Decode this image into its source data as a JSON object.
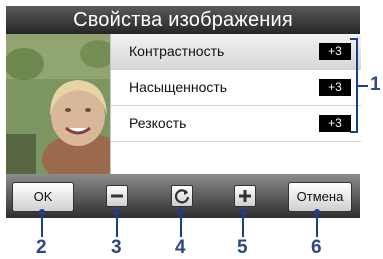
{
  "window": {
    "title": "Свойства изображения"
  },
  "properties": [
    {
      "label": "Контрастность",
      "value": "+3"
    },
    {
      "label": "Насыщенность",
      "value": "+3"
    },
    {
      "label": "Резкость",
      "value": "+3"
    }
  ],
  "toolbar": {
    "ok_label": "OK",
    "cancel_label": "Отмена"
  },
  "callouts": {
    "c1": "1",
    "c2": "2",
    "c3": "3",
    "c4": "4",
    "c5": "5",
    "c6": "6"
  },
  "colors": {
    "title_bar": "#333333",
    "selected_row": "#dcdcdc",
    "toolbar": "#4a4a4a",
    "callout": "#2c4a7e"
  },
  "icons": [
    "minus-icon",
    "rotate-icon",
    "plus-icon"
  ]
}
